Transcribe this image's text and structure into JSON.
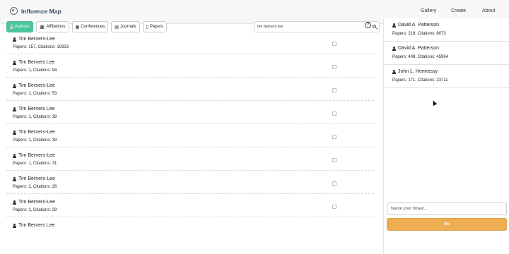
{
  "brand": {
    "title": "Influence Map",
    "logo_icon": "globe-icon"
  },
  "nav": [
    {
      "label": "Gallery"
    },
    {
      "label": "Create"
    },
    {
      "label": "About"
    }
  ],
  "tabs": [
    {
      "label": "Authors",
      "icon": "person-icon",
      "active": true
    },
    {
      "label": "Affiliations",
      "icon": "institution-icon",
      "active": false
    },
    {
      "label": "Conferences",
      "icon": "building-icon",
      "active": false
    },
    {
      "label": "Journals",
      "icon": "book-icon",
      "active": false
    },
    {
      "label": "Papers",
      "icon": "document-icon",
      "active": false
    }
  ],
  "search": {
    "value": "tim berners lee",
    "placeholder": ""
  },
  "results": [
    {
      "name": "Tim Berners-Lee",
      "stats": "Papers: 157, Citations: 19333"
    },
    {
      "name": "Tim Berners Lee",
      "stats": "Papers: 1, Citations: 94"
    },
    {
      "name": "Tim Berners-Lee",
      "stats": "Papers: 1, Citations: 53"
    },
    {
      "name": "Tim Berners Lee",
      "stats": "Papers: 1, Citations: 38"
    },
    {
      "name": "Tim Berners-Lee",
      "stats": "Papers: 1, Citations: 39"
    },
    {
      "name": "Tim Berners-Lee",
      "stats": "Papers: 1, Citations: 31"
    },
    {
      "name": "Tim Berners-Lee",
      "stats": "Papers: 2, Citations: 26"
    },
    {
      "name": "Tim Berners-Lee",
      "stats": "Papers: 1, Citations: 29"
    },
    {
      "name": "Tim Berners Lee",
      "stats": ""
    }
  ],
  "selected": [
    {
      "name": "David A. Patterson",
      "stats": "Papers: 219, Citations: 8073"
    },
    {
      "name": "David A. Patterson",
      "stats": "Papers: 408, Citations: 45964"
    },
    {
      "name": "John L. Hennessy",
      "stats": "Papers: 171, Citations: 23711"
    }
  ],
  "flower": {
    "placeholder": "Name your flower...",
    "value": ""
  },
  "go_label": "Go",
  "colors": {
    "accent": "#4cc69b",
    "go": "#efad52",
    "brand": "#3b4d61"
  }
}
